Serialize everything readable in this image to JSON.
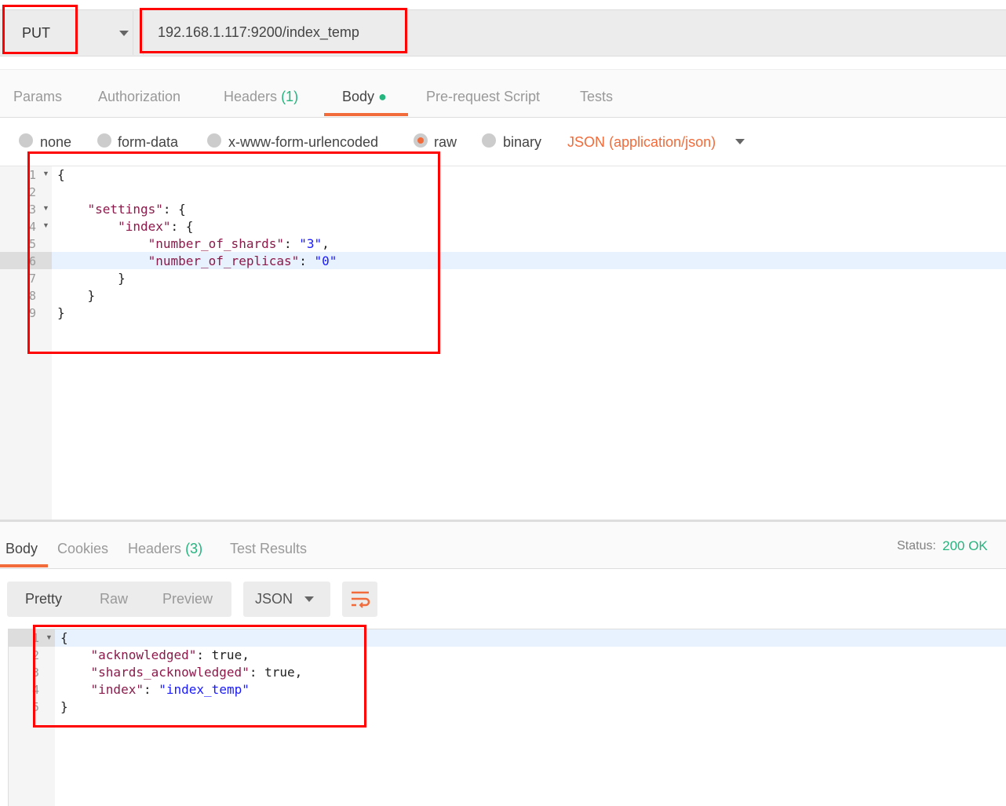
{
  "request": {
    "method": "PUT",
    "url": "192.168.1.117:9200/index_temp"
  },
  "request_tabs": [
    {
      "label": "Params"
    },
    {
      "label": "Authorization"
    },
    {
      "label": "Headers",
      "count": "(1)"
    },
    {
      "label": "Body",
      "active": true
    },
    {
      "label": "Pre-request Script"
    },
    {
      "label": "Tests"
    }
  ],
  "body_types": [
    {
      "label": "none"
    },
    {
      "label": "form-data"
    },
    {
      "label": "x-www-form-urlencoded"
    },
    {
      "label": "raw",
      "selected": true
    },
    {
      "label": "binary"
    }
  ],
  "content_type": "JSON (application/json)",
  "request_body": {
    "line_numbers": [
      "1",
      "2",
      "3",
      "4",
      "5",
      "6",
      "7",
      "8",
      "9"
    ],
    "lines": [
      "{",
      "",
      "    \"settings\": {",
      "        \"index\": {",
      "            \"number_of_shards\": \"3\",",
      "            \"number_of_replicas\": \"0\"",
      "        }",
      "    }",
      "}"
    ]
  },
  "response_tabs": [
    {
      "label": "Body",
      "active": true
    },
    {
      "label": "Cookies"
    },
    {
      "label": "Headers",
      "count": "(3)"
    },
    {
      "label": "Test Results"
    }
  ],
  "status": {
    "label": "Status:",
    "value": "200 OK"
  },
  "view_modes": [
    "Pretty",
    "Raw",
    "Preview"
  ],
  "format": "JSON",
  "response_body": {
    "line_numbers": [
      "1",
      "2",
      "3",
      "4",
      "5"
    ],
    "lines": [
      "{",
      "    \"acknowledged\": true,",
      "    \"shards_acknowledged\": true,",
      "    \"index\": \"index_temp\"",
      "}"
    ]
  },
  "colors": {
    "accent": "#f26b3a",
    "success": "#26b47f",
    "annotation": "#ff0000"
  }
}
